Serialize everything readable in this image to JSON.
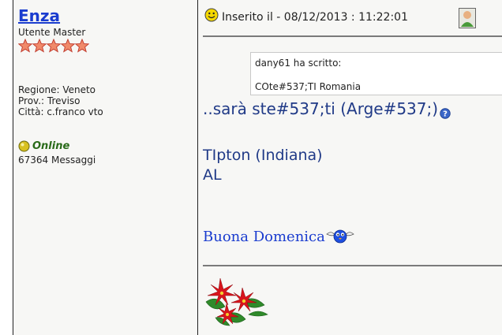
{
  "author": {
    "name": "Enza",
    "rank": "Utente Master",
    "region": "Regione: Veneto",
    "province": "Prov.: Treviso",
    "city": "Città: c.franco vto",
    "status": "Online",
    "messages": "67364 Messaggi",
    "star_count": 5,
    "status_color": "#2a6b1a"
  },
  "post": {
    "posted_label": "Inserito il  -  08/12/2013 :  11:22:01",
    "quote": {
      "author_line": "dany61 ha scritto:",
      "text": "COte#537;TI Romania"
    },
    "body_line1": "..sarà ste#537;ti (Arge#537;)",
    "body_line2": "TIpton (Indiana)",
    "body_line3": "AL",
    "greeting": "Buona Domenica"
  },
  "icons": [
    "smiley-icon",
    "profile-icon",
    "help-icon",
    "bird-emoticon",
    "poinsettia-image",
    "online-status-icon",
    "rank-star-icon"
  ],
  "colors": {
    "link": "#1a3ccf",
    "body_text": "#203a87",
    "panel_bg": "#f7f7f5"
  }
}
